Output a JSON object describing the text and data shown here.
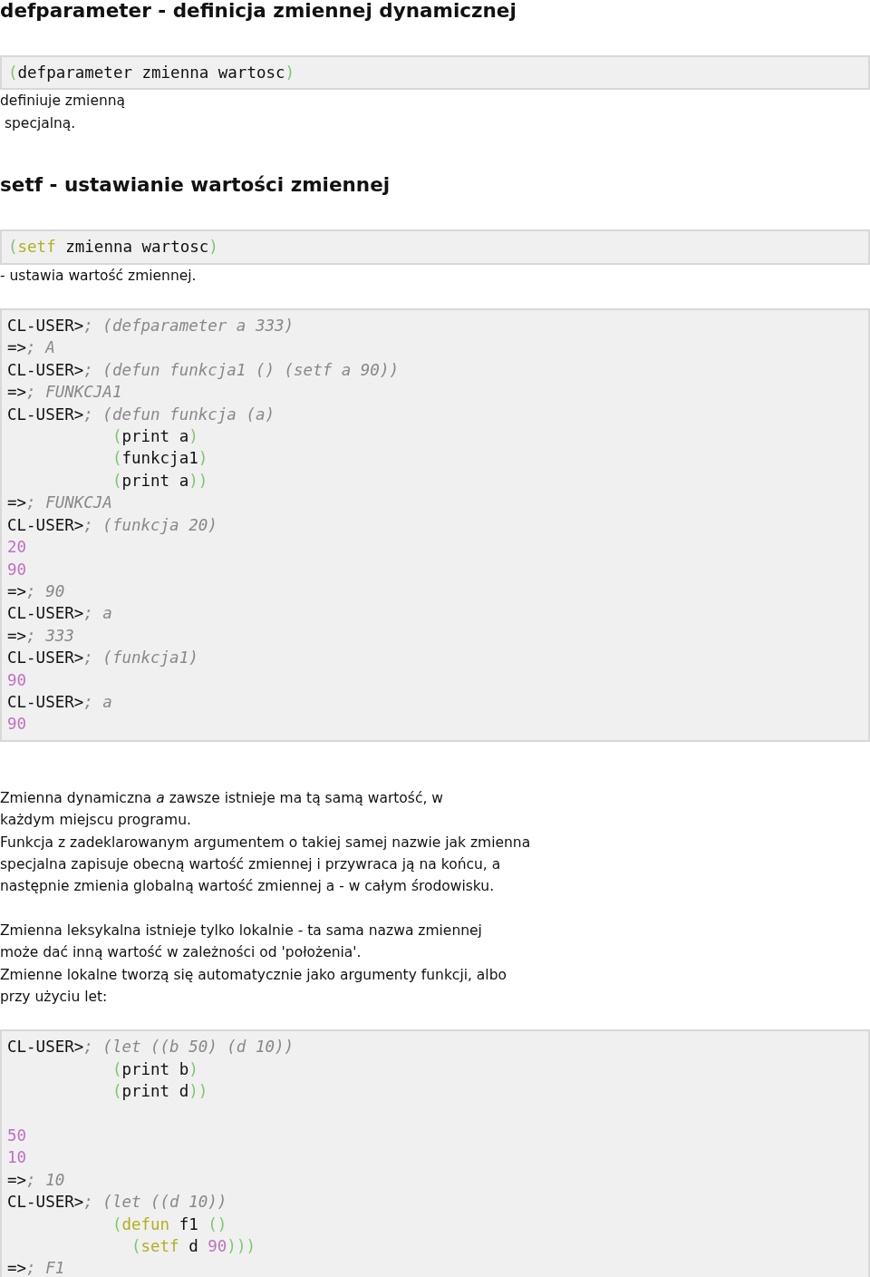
{
  "sections": [
    {
      "kind": "heading",
      "text": "defparameter - definicja zmiennej dynamicznej"
    },
    {
      "kind": "code",
      "inline": true,
      "lines": [
        {
          "kind": "code",
          "tokens": [
            {
              "kind": "paren",
              "text": "("
            },
            {
              "kind": "plain",
              "text": "defparameter zmienna wartosc"
            },
            {
              "kind": "paren",
              "text": ")"
            }
          ]
        }
      ]
    },
    {
      "kind": "text",
      "text": "definiuje zmienną\n specjalną."
    },
    {
      "kind": "heading",
      "text": "setf - ustawianie wartości zmiennej"
    },
    {
      "kind": "code",
      "inline": true,
      "lines": [
        {
          "kind": "code",
          "tokens": [
            {
              "kind": "paren",
              "text": "("
            },
            {
              "kind": "keyword",
              "text": "setf"
            },
            {
              "kind": "plain",
              "text": " zmienna wartosc"
            },
            {
              "kind": "paren",
              "text": ")"
            }
          ]
        }
      ]
    },
    {
      "kind": "text",
      "text": "- ustawia wartość zmiennej."
    },
    {
      "kind": "code",
      "inline": false,
      "lines": [
        {
          "kind": "code",
          "tokens": [
            {
              "kind": "plain",
              "text": "CL-USER>"
            },
            {
              "kind": "comment",
              "text": "; (defparameter a 333)"
            }
          ]
        },
        {
          "kind": "code",
          "tokens": [
            {
              "kind": "plain",
              "text": "=>"
            },
            {
              "kind": "comment",
              "text": "; A"
            }
          ]
        },
        {
          "kind": "code",
          "tokens": [
            {
              "kind": "plain",
              "text": "CL-USER>"
            },
            {
              "kind": "comment",
              "text": "; (defun funkcja1 () (setf a 90))"
            }
          ]
        },
        {
          "kind": "code",
          "tokens": [
            {
              "kind": "plain",
              "text": "=>"
            },
            {
              "kind": "comment",
              "text": "; FUNKCJA1"
            }
          ]
        },
        {
          "kind": "code",
          "tokens": [
            {
              "kind": "plain",
              "text": "CL-USER>"
            },
            {
              "kind": "comment",
              "text": "; (defun funkcja (a)"
            }
          ]
        },
        {
          "kind": "code",
          "tokens": [
            {
              "kind": "paren",
              "text": "           ("
            },
            {
              "kind": "plain",
              "text": "print a"
            },
            {
              "kind": "paren",
              "text": ")"
            }
          ]
        },
        {
          "kind": "code",
          "tokens": [
            {
              "kind": "paren",
              "text": "           ("
            },
            {
              "kind": "plain",
              "text": "funkcja1"
            },
            {
              "kind": "paren",
              "text": ")"
            }
          ]
        },
        {
          "kind": "code",
          "tokens": [
            {
              "kind": "paren",
              "text": "           ("
            },
            {
              "kind": "plain",
              "text": "print a"
            },
            {
              "kind": "paren",
              "text": "))"
            }
          ]
        },
        {
          "kind": "code",
          "tokens": [
            {
              "kind": "plain",
              "text": "=>"
            },
            {
              "kind": "comment",
              "text": "; FUNKCJA"
            }
          ]
        },
        {
          "kind": "code",
          "tokens": [
            {
              "kind": "plain",
              "text": "CL-USER>"
            },
            {
              "kind": "comment",
              "text": "; (funkcja 20)"
            }
          ]
        },
        {
          "kind": "code",
          "tokens": [
            {
              "kind": "number",
              "text": "20"
            }
          ]
        },
        {
          "kind": "code",
          "tokens": [
            {
              "kind": "number",
              "text": "90"
            }
          ]
        },
        {
          "kind": "code",
          "tokens": [
            {
              "kind": "plain",
              "text": "=>"
            },
            {
              "kind": "comment",
              "text": "; 90"
            }
          ]
        },
        {
          "kind": "code",
          "tokens": [
            {
              "kind": "plain",
              "text": "CL-USER>"
            },
            {
              "kind": "comment",
              "text": "; a"
            }
          ]
        },
        {
          "kind": "code",
          "tokens": [
            {
              "kind": "plain",
              "text": "=>"
            },
            {
              "kind": "comment",
              "text": "; 333"
            }
          ]
        },
        {
          "kind": "code",
          "tokens": [
            {
              "kind": "plain",
              "text": "CL-USER>"
            },
            {
              "kind": "comment",
              "text": "; (funkcja1)"
            }
          ]
        },
        {
          "kind": "code",
          "tokens": [
            {
              "kind": "number",
              "text": "90"
            }
          ]
        },
        {
          "kind": "code",
          "tokens": [
            {
              "kind": "plain",
              "text": "CL-USER>"
            },
            {
              "kind": "comment",
              "text": "; a"
            }
          ]
        },
        {
          "kind": "code",
          "tokens": [
            {
              "kind": "number",
              "text": "90"
            }
          ]
        }
      ]
    },
    {
      "kind": "text",
      "text": "Zmienna dynamiczna *a* zawsze istnieje ma tą samą wartość, w\nkażdym miejscu programu.\nFunkcja z zadeklarowanym argumentem o takiej samej nazwie jak zmienna\nspecjalna zapisuje obecną wartość zmiennej i przywraca ją na końcu, a\nnastępnie zmienia globalną wartość zmiennej a - w całym środowisku."
    },
    {
      "kind": "text",
      "text": "Zmienna leksykalna istnieje tylko lokalnie - ta sama nazwa zmiennej\nmoże dać inną wartość w zależności od 'położenia'.\nZmienne lokalne tworzą się automatycznie jako argumenty funkcji, albo\nprzy użyciu let:"
    },
    {
      "kind": "code",
      "inline": false,
      "lines": [
        {
          "kind": "code",
          "tokens": [
            {
              "kind": "plain",
              "text": "CL-USER>"
            },
            {
              "kind": "comment",
              "text": "; (let ((b 50) (d 10))"
            }
          ]
        },
        {
          "kind": "code",
          "tokens": [
            {
              "kind": "paren",
              "text": "           ("
            },
            {
              "kind": "plain",
              "text": "print b"
            },
            {
              "kind": "paren",
              "text": ")"
            }
          ]
        },
        {
          "kind": "code",
          "tokens": [
            {
              "kind": "paren",
              "text": "           ("
            },
            {
              "kind": "plain",
              "text": "print d"
            },
            {
              "kind": "paren",
              "text": "))"
            }
          ]
        },
        {
          "kind": "blank"
        },
        {
          "kind": "code",
          "tokens": [
            {
              "kind": "number",
              "text": "50"
            }
          ]
        },
        {
          "kind": "code",
          "tokens": [
            {
              "kind": "number",
              "text": "10"
            }
          ]
        },
        {
          "kind": "code",
          "tokens": [
            {
              "kind": "plain",
              "text": "=>"
            },
            {
              "kind": "comment",
              "text": "; 10"
            }
          ]
        },
        {
          "kind": "code",
          "tokens": [
            {
              "kind": "plain",
              "text": "CL-USER>"
            },
            {
              "kind": "comment",
              "text": "; (let ((d 10))"
            }
          ]
        },
        {
          "kind": "code",
          "tokens": [
            {
              "kind": "paren",
              "text": "           ("
            },
            {
              "kind": "keyword",
              "text": "defun"
            },
            {
              "kind": "plain",
              "text": " f1 "
            },
            {
              "kind": "paren",
              "text": "()"
            }
          ]
        },
        {
          "kind": "code",
          "tokens": [
            {
              "kind": "paren",
              "text": "             ("
            },
            {
              "kind": "keyword",
              "text": "setf"
            },
            {
              "kind": "plain",
              "text": " d "
            },
            {
              "kind": "number",
              "text": "90"
            },
            {
              "kind": "paren",
              "text": ")))"
            }
          ]
        },
        {
          "kind": "code",
          "tokens": [
            {
              "kind": "plain",
              "text": "=>"
            },
            {
              "kind": "comment",
              "text": "; F1"
            }
          ]
        }
      ]
    }
  ]
}
